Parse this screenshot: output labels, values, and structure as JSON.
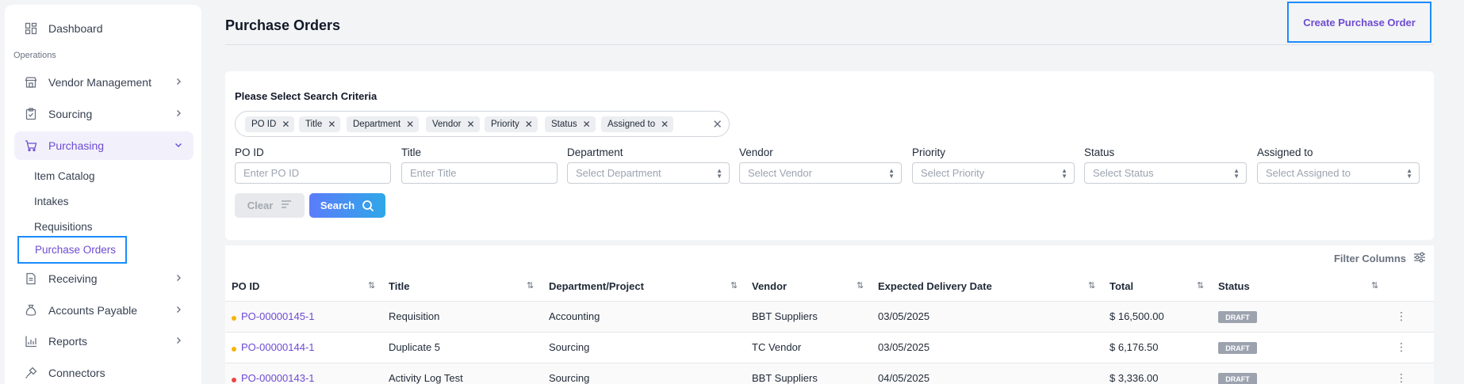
{
  "sidebar": {
    "dashboard": "Dashboard",
    "section_operations": "Operations",
    "vendor_management": "Vendor Management",
    "sourcing": "Sourcing",
    "purchasing": "Purchasing",
    "item_catalog": "Item Catalog",
    "intakes": "Intakes",
    "requisitions": "Requisitions",
    "purchase_orders": "Purchase Orders",
    "receiving": "Receiving",
    "accounts_payable": "Accounts Payable",
    "reports": "Reports",
    "connectors": "Connectors"
  },
  "header": {
    "title": "Purchase Orders",
    "create_button": "Create Purchase Order"
  },
  "search": {
    "title": "Please Select Search Criteria",
    "chips": [
      "PO ID",
      "Title",
      "Department",
      "Vendor",
      "Priority",
      "Status",
      "Assigned to"
    ],
    "fields": {
      "po_id": {
        "label": "PO ID",
        "placeholder": "Enter PO ID"
      },
      "title": {
        "label": "Title",
        "placeholder": "Enter Title"
      },
      "department": {
        "label": "Department",
        "placeholder": "Select Department"
      },
      "vendor": {
        "label": "Vendor",
        "placeholder": "Select Vendor"
      },
      "priority": {
        "label": "Priority",
        "placeholder": "Select Priority"
      },
      "status": {
        "label": "Status",
        "placeholder": "Select Status"
      },
      "assigned_to": {
        "label": "Assigned to",
        "placeholder": "Select Assigned to"
      }
    },
    "clear_button": "Clear",
    "search_button": "Search"
  },
  "table": {
    "filter_columns": "Filter Columns",
    "headers": [
      "PO ID",
      "Title",
      "Department/Project",
      "Vendor",
      "Expected Delivery Date",
      "Total",
      "Status"
    ],
    "rows": [
      {
        "po_id": "PO-00000145-1",
        "title": "Requisition",
        "department": "Accounting",
        "vendor": "BBT Suppliers",
        "delivery": "03/05/2025",
        "total": "$ 16,500.00",
        "status": "DRAFT",
        "priority_color": "#f5b400"
      },
      {
        "po_id": "PO-00000144-1",
        "title": "Duplicate 5",
        "department": "Sourcing",
        "vendor": "TC Vendor",
        "delivery": "03/05/2025",
        "total": "$ 6,176.50",
        "status": "DRAFT",
        "priority_color": "#f5b400"
      },
      {
        "po_id": "PO-00000143-1",
        "title": "Activity Log Test",
        "department": "Sourcing",
        "vendor": "BBT Suppliers",
        "delivery": "04/05/2025",
        "total": "$ 3,336.00",
        "status": "DRAFT",
        "priority_color": "#ef4444"
      }
    ]
  },
  "colors": {
    "accent": "#6d4bd3",
    "highlight_border": "#1a8cff",
    "search_gradient_start": "#5b7cfa",
    "search_gradient_end": "#2fa7e8"
  }
}
